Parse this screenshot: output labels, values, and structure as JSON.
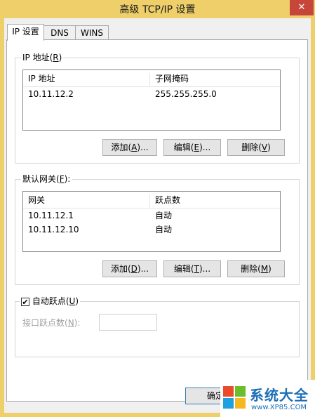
{
  "window": {
    "title": "高级 TCP/IP 设置",
    "close_glyph": "✕"
  },
  "tabs": [
    {
      "label": "IP 设置",
      "active": true
    },
    {
      "label": "DNS",
      "active": false
    },
    {
      "label": "WINS",
      "active": false
    }
  ],
  "ip_section": {
    "legend_text": "IP 地址(",
    "legend_key": "R",
    "legend_end": ")",
    "columns": [
      "IP 地址",
      "子网掩码"
    ],
    "rows": [
      {
        "ip": "10.11.12.2",
        "mask": "255.255.255.0"
      }
    ],
    "buttons": {
      "add": {
        "text": "添加(",
        "key": "A",
        "end": ")..."
      },
      "edit": {
        "text": "编辑(",
        "key": "E",
        "end": ")..."
      },
      "delete": {
        "text": "删除(",
        "key": "V",
        "end": ")"
      }
    }
  },
  "gateway_section": {
    "legend_text": "默认网关(",
    "legend_key": "F",
    "legend_end": "):",
    "columns": [
      "网关",
      "跃点数"
    ],
    "rows": [
      {
        "gateway": "10.11.12.1",
        "metric": "自动"
      },
      {
        "gateway": "10.11.12.10",
        "metric": "自动"
      }
    ],
    "buttons": {
      "add": {
        "text": "添加(",
        "key": "D",
        "end": ")..."
      },
      "edit": {
        "text": "编辑(",
        "key": "T",
        "end": ")..."
      },
      "delete": {
        "text": "删除(",
        "key": "M",
        "end": ")"
      }
    }
  },
  "auto_metric": {
    "checked": true,
    "check_glyph": "✔",
    "label_text": "自动跃点(",
    "label_key": "U",
    "label_end": ")",
    "interface_label_text": "接口跃点数(",
    "interface_label_key": "N",
    "interface_label_end": "):",
    "interface_value": ""
  },
  "footer": {
    "ok_partial": "确定"
  },
  "watermark": {
    "text": "系统大全",
    "url": "www.XP85.COM"
  },
  "colors": {
    "titlebar": "#eecf6a",
    "close": "#c7463a",
    "panel": "#f0f0f0"
  }
}
